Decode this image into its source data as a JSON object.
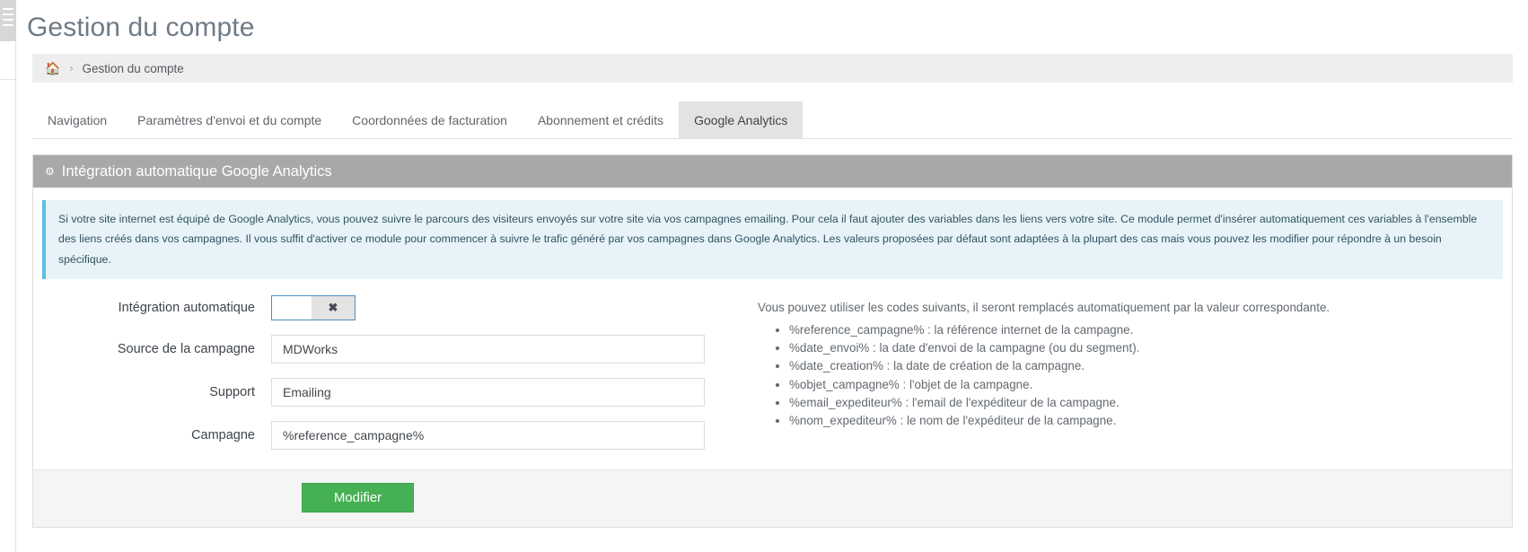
{
  "page": {
    "title": "Gestion du compte"
  },
  "breadcrumb": {
    "home_icon": "home-icon",
    "separator": "›",
    "current": "Gestion du compte"
  },
  "tabs": [
    {
      "label": "Navigation",
      "active": false
    },
    {
      "label": "Paramètres d'envoi et du compte",
      "active": false
    },
    {
      "label": "Coordonnées de facturation",
      "active": false
    },
    {
      "label": "Abonnement et crédits",
      "active": false
    },
    {
      "label": "Google Analytics",
      "active": true
    }
  ],
  "panel": {
    "icon": "gear-icon",
    "title": "Intégration automatique Google Analytics",
    "alert": "Si votre site internet est équipé de Google Analytics, vous pouvez suivre le parcours des visiteurs envoyés sur votre site via vos campagnes emailing. Pour cela il faut ajouter des variables dans les liens vers votre site. Ce module permet d'insérer automatiquement ces variables à l'ensemble des liens créés dans vos campagnes. Il vous suffit d'activer ce module pour commencer à suivre le trafic généré par vos campagnes dans Google Analytics. Les valeurs proposées par défaut sont adaptées à la plupart des cas mais vous pouvez les modifier pour répondre à un besoin spécifique."
  },
  "form": {
    "toggle": {
      "label": "Intégration automatique",
      "off_glyph": "✖",
      "state": "off"
    },
    "fields": [
      {
        "label": "Source de la campagne",
        "value": "MDWorks",
        "placeholder": ""
      },
      {
        "label": "Support",
        "value": "Emailing",
        "placeholder": ""
      },
      {
        "label": "Campagne",
        "value": "%reference_campagne%",
        "placeholder": ""
      }
    ],
    "submit_label": "Modifier"
  },
  "codes": {
    "intro": "Vous pouvez utiliser les codes suivants, il seront remplacés automatiquement par la valeur correspondante.",
    "items": [
      "%reference_campagne% : la référence internet de la campagne.",
      "%date_envoi% : la date d'envoi de la campagne (ou du segment).",
      "%date_creation% : la date de création de la campagne.",
      "%objet_campagne% : l'objet de la campagne.",
      "%email_expediteur% : l'email de l'expéditeur de la campagne.",
      "%nom_expediteur% : le nom de l'expéditeur de la campagne."
    ]
  },
  "colors": {
    "panel_header_bg": "#a8a8a8",
    "alert_bg": "#e7f3f9",
    "alert_border": "#5bc0de",
    "primary_button": "#46b055",
    "active_tab_bg": "#e3e3e3",
    "title_text": "#6f7b86"
  }
}
